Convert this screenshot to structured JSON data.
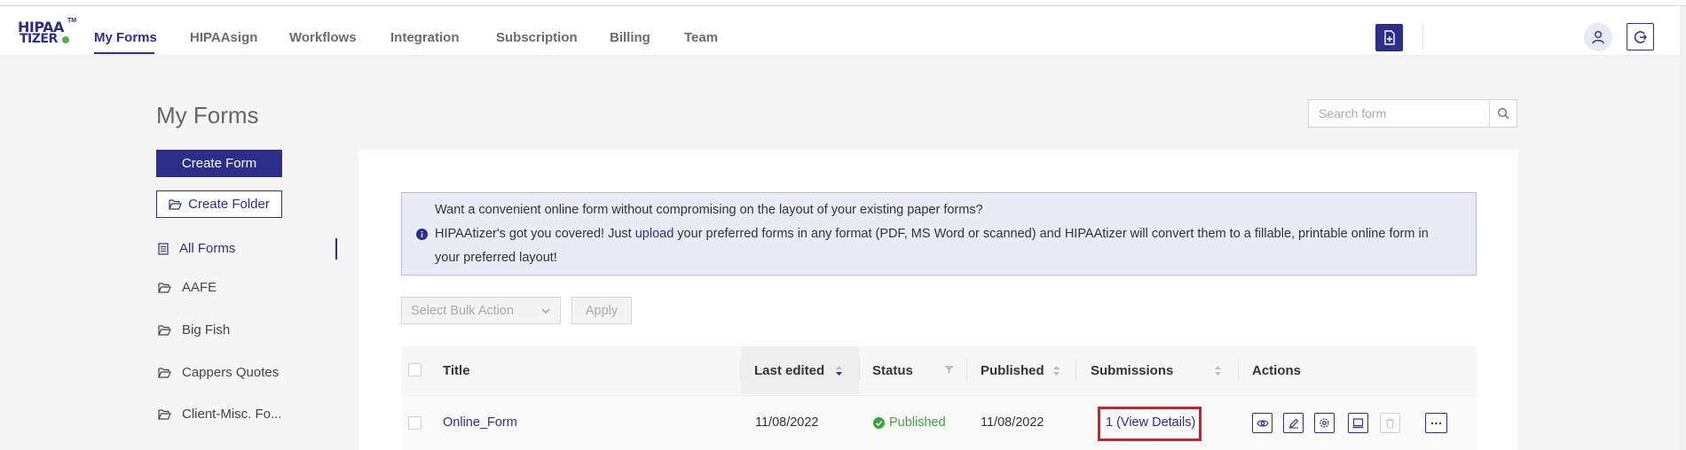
{
  "brand": {
    "logo_line1": "HIPAA",
    "logo_line2": "TIZER",
    "logo_tm": "TM"
  },
  "nav": {
    "items": [
      {
        "label": "My Forms",
        "active": true
      },
      {
        "label": "HIPAAsign"
      },
      {
        "label": "Workflows"
      },
      {
        "label": "Integration"
      },
      {
        "label": "Subscription"
      },
      {
        "label": "Billing"
      },
      {
        "label": "Team"
      }
    ],
    "icons": [
      "document-plus-icon",
      "user-icon",
      "logout-icon"
    ]
  },
  "page": {
    "title": "My Forms"
  },
  "search": {
    "placeholder": "Search form",
    "value": ""
  },
  "sidebar": {
    "create_form_label": "Create Form",
    "create_folder_label": "Create Folder",
    "items": [
      {
        "label": "All Forms",
        "icon": "form-list-icon",
        "active": true
      },
      {
        "label": "AAFE",
        "icon": "folder-icon"
      },
      {
        "label": "Big Fish",
        "icon": "folder-icon"
      },
      {
        "label": "Cappers Quotes",
        "icon": "folder-icon"
      },
      {
        "label": "Client-Misc. Fo...",
        "icon": "folder-icon"
      }
    ]
  },
  "info": {
    "line1": "Want a convenient online form without compromising on the layout of your existing paper forms?",
    "line2_before": "HIPAAtizer's got you covered! Just ",
    "line2_link": "upload",
    "line2_after": " your preferred forms in any format (PDF, MS Word or scanned) and HIPAAtizer will convert them to a fillable, printable online form in",
    "line3": "your preferred layout!"
  },
  "bulk": {
    "select_placeholder": "Select Bulk Action",
    "apply_label": "Apply"
  },
  "table": {
    "columns": [
      "Title",
      "Last edited",
      "Status",
      "Published",
      "Submissions",
      "Actions"
    ],
    "sorted_column": "Last edited",
    "rows": [
      {
        "title": "Online_Form",
        "last_edited": "11/08/2022",
        "status": "Published",
        "published": "11/08/2022",
        "submissions": "1 (View Details)"
      }
    ],
    "row_actions": [
      "view-icon",
      "edit-icon",
      "settings-icon",
      "embed-icon",
      "delete-icon",
      "more-icon"
    ]
  },
  "colors": {
    "brand": "#2b2f8a",
    "published": "#3aa53a",
    "highlight": "#e8141e",
    "info_bg": "#e9ebf7"
  }
}
